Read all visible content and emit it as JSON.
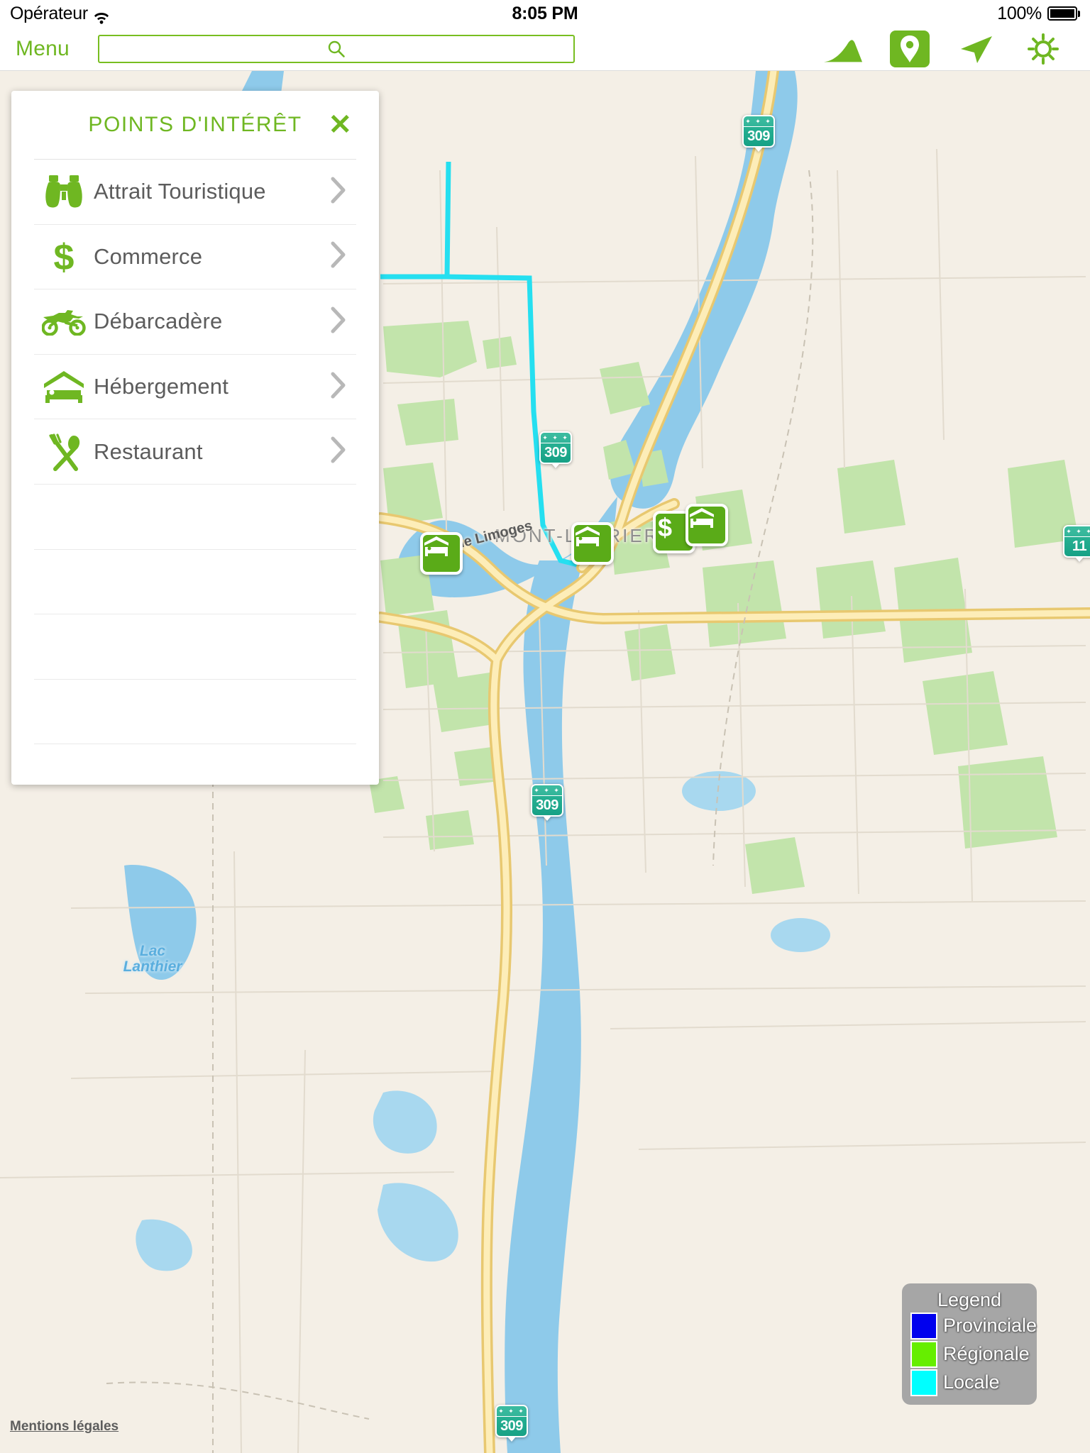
{
  "status_bar": {
    "carrier": "Opérateur",
    "wifi_icon": "wifi-icon",
    "time": "8:05 PM",
    "battery_percent": "100%",
    "battery_icon": "battery-full-icon"
  },
  "toolbar": {
    "menu_label": "Menu",
    "search_value": "",
    "search_placeholder": "",
    "search_icon": "search-icon",
    "buttons": [
      {
        "name": "terrain-icon",
        "label": "Relief",
        "active": false
      },
      {
        "name": "map-pin-icon",
        "label": "Points d'intérêt",
        "active": true
      },
      {
        "name": "navigation-arrow-icon",
        "label": "Localisation",
        "active": false
      },
      {
        "name": "gear-icon",
        "label": "Réglages",
        "active": false
      }
    ]
  },
  "poi_panel": {
    "title": "POINTS D'INTÉRÊT",
    "close_label": "✕",
    "close_icon": "close-icon",
    "chevron_icon": "chevron-right-icon",
    "items": [
      {
        "label": "Attrait Touristique",
        "icon": "binoculars-icon"
      },
      {
        "label": "Commerce",
        "icon": "dollar-sign-icon"
      },
      {
        "label": "Débarcadère",
        "icon": "motorcycle-icon"
      },
      {
        "label": "Hébergement",
        "icon": "bed-lodging-icon"
      },
      {
        "label": "Restaurant",
        "icon": "fork-spoon-icon"
      }
    ],
    "empty_rows": 4
  },
  "map": {
    "place_label": "MONT-LAURIER",
    "lake_label_line1": "Lac",
    "lake_label_line2": "Lanthier",
    "street_label": "Rue Limoges",
    "shields": [
      {
        "number": "309"
      },
      {
        "number": "309"
      },
      {
        "number": "309"
      },
      {
        "number": "309"
      },
      {
        "number": "11"
      }
    ],
    "markers": [
      {
        "icon": "bed-lodging-icon",
        "type": "Hébergement"
      },
      {
        "icon": "bed-lodging-icon",
        "type": "Hébergement"
      },
      {
        "icon": "dollar-sign-icon",
        "type": "Commerce"
      },
      {
        "icon": "bed-lodging-icon",
        "type": "Hébergement"
      }
    ],
    "colors": {
      "land": "#f4efe6",
      "water": "#8ecaea",
      "park": "#b9e3a0",
      "road": "#fbe2a0",
      "local_route": "#00e6f0"
    }
  },
  "legend": {
    "title": "Legend",
    "entries": [
      {
        "label": "Provinciale",
        "color": "#0000ee"
      },
      {
        "label": "Régionale",
        "color": "#66ee00"
      },
      {
        "label": "Locale",
        "color": "#00ffff"
      }
    ]
  },
  "footer": {
    "legal_link": "Mentions légales"
  }
}
